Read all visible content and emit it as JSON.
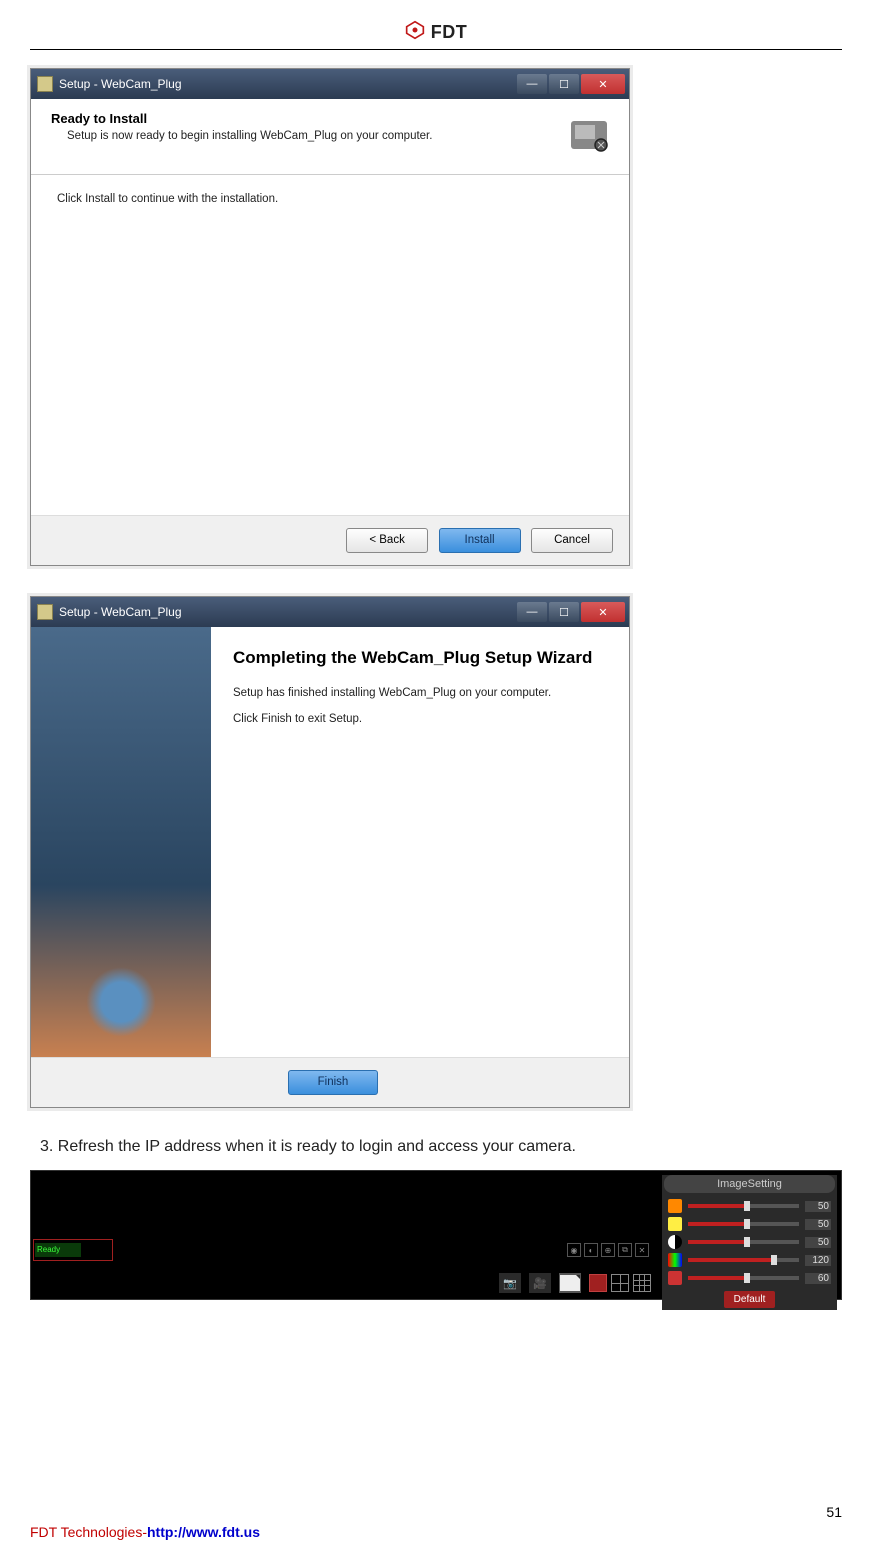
{
  "header": {
    "brand": "FDT"
  },
  "dialog1": {
    "title": "Setup - WebCam_Plug",
    "heading": "Ready to Install",
    "subheading": "Setup is now ready to begin installing WebCam_Plug on your computer.",
    "body": "Click Install to continue with the installation.",
    "buttons": {
      "back": "< Back",
      "install": "Install",
      "cancel": "Cancel"
    }
  },
  "dialog2": {
    "title": "Setup - WebCam_Plug",
    "heading": "Completing the WebCam_Plug Setup Wizard",
    "line1": "Setup has finished installing WebCam_Plug on your computer.",
    "line2": "Click Finish to exit Setup.",
    "buttons": {
      "finish": "Finish"
    }
  },
  "step3": "3. Refresh the IP address when it is ready to login and access your camera.",
  "camera": {
    "ready_label": "Ready",
    "panel_title": "ImageSetting",
    "sliders": [
      {
        "name": "hue",
        "value": 50,
        "max": 100
      },
      {
        "name": "brightness",
        "value": 50,
        "max": 100
      },
      {
        "name": "contrast",
        "value": 50,
        "max": 100
      },
      {
        "name": "saturation",
        "value": 120,
        "max": 160
      },
      {
        "name": "sharpness",
        "value": 60,
        "max": 120
      }
    ],
    "default_btn": "Default"
  },
  "footer": {
    "page": "51",
    "company": "FDT Technologies-",
    "url": "http://www.fdt.us"
  }
}
